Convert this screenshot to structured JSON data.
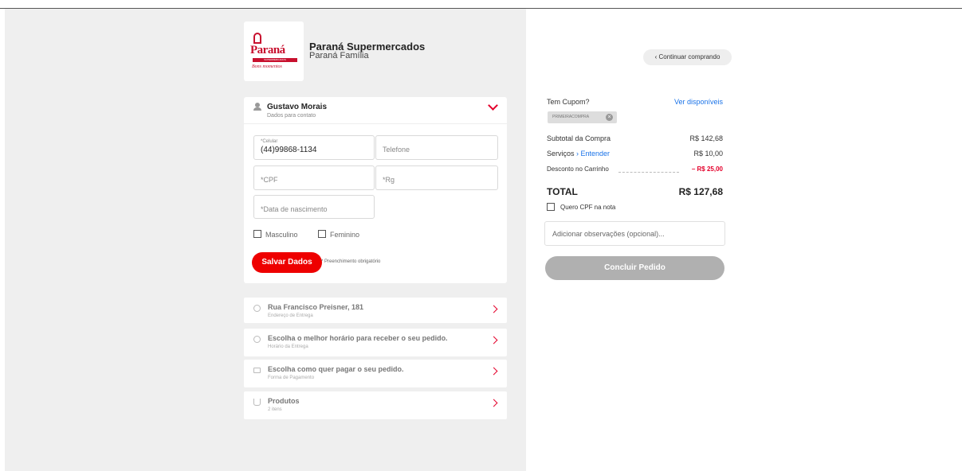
{
  "store": {
    "logo_text": "Paraná",
    "logo_sub": "SUPERMERCADOS",
    "logo_slogan": "Bons momentos",
    "name": "Paraná Supermercados",
    "subtitle": "Paraná Família"
  },
  "contact": {
    "name": "Gustavo Morais",
    "subtitle": "Dados para contato",
    "fields": {
      "celular_label": "*Celular",
      "celular_value": "(44)99868-1134",
      "telefone_placeholder": "Telefone",
      "cpf_placeholder": "*CPF",
      "rg_placeholder": "*Rg",
      "nascimento_placeholder": "*Data de nascimento"
    },
    "gender": {
      "male": "Masculino",
      "female": "Feminino"
    },
    "save_label": "Salvar Dados",
    "required_note": "* Preenchimento obrigatório"
  },
  "steps": [
    {
      "title": "Rua Francisco Preisner, 181",
      "subtitle": "Endereço de Entrega"
    },
    {
      "title": "Escolha o melhor horário para receber o seu pedido.",
      "subtitle": "Horário da Entrega"
    },
    {
      "title": "Escolha como quer pagar o seu pedido.",
      "subtitle": "Forma de Pagamento"
    },
    {
      "title": "Produtos",
      "subtitle": "2 itens"
    }
  ],
  "summary": {
    "continue_label": "‹ Continuar comprando",
    "coupon_question": "Tem Cupom?",
    "coupon_link": "Ver disponíveis",
    "coupon_code": "PRIMEIRACOMPRA",
    "subtotal_label": "Subtotal da Compra",
    "subtotal_value": "R$ 142,68",
    "services_label": "Serviços",
    "services_link": "› Entender",
    "services_value": "R$ 10,00",
    "discount_label": "Desconto no Carrinho",
    "discount_value": "– R$ 25,00",
    "total_label": "TOTAL",
    "total_value": "R$ 127,68",
    "cpf_note_label": "Quero CPF na nota",
    "obs_placeholder": "Adicionar observações (opcional)...",
    "conclude_label": "Concluir Pedido"
  },
  "colors": {
    "accent": "#e4002b",
    "link": "#1a73e8",
    "disabled": "#b0b0b0"
  }
}
